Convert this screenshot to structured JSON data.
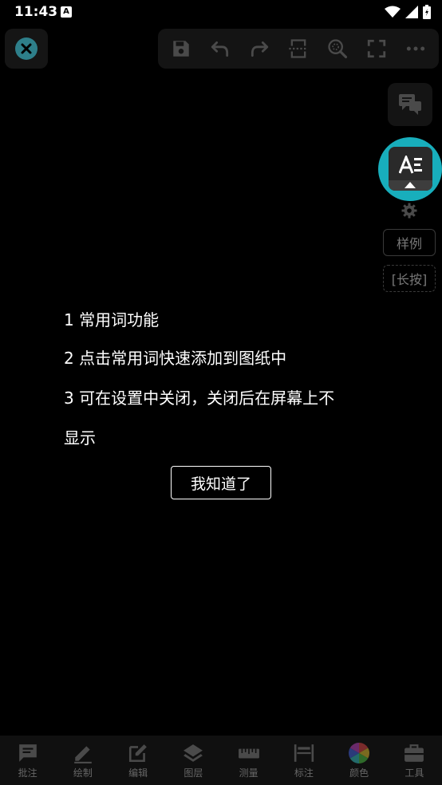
{
  "status_bar": {
    "time": "11:43",
    "notification_badge": "A"
  },
  "sidebar": {
    "legend_label": "样例",
    "longpress_label": "[长按]"
  },
  "guide": {
    "lines": [
      "1 常用词功能",
      "2 点击常用词快速添加到图纸中",
      "3 可在设置中关闭，关闭后在屏幕上不",
      "显示"
    ],
    "confirm_label": "我知道了"
  },
  "bottom_nav": {
    "items": [
      {
        "label": "批注",
        "icon": "comment-icon"
      },
      {
        "label": "绘制",
        "icon": "pencil-icon"
      },
      {
        "label": "编辑",
        "icon": "edit-icon"
      },
      {
        "label": "图层",
        "icon": "layers-icon"
      },
      {
        "label": "测量",
        "icon": "ruler-icon"
      },
      {
        "label": "标注",
        "icon": "dimension-icon"
      },
      {
        "label": "颜色",
        "icon": "color-wheel-icon"
      },
      {
        "label": "工具",
        "icon": "toolbox-icon"
      }
    ]
  },
  "colors": {
    "accent": "#18aebc",
    "background": "#000000",
    "icon_dim": "#4a4a4a"
  }
}
